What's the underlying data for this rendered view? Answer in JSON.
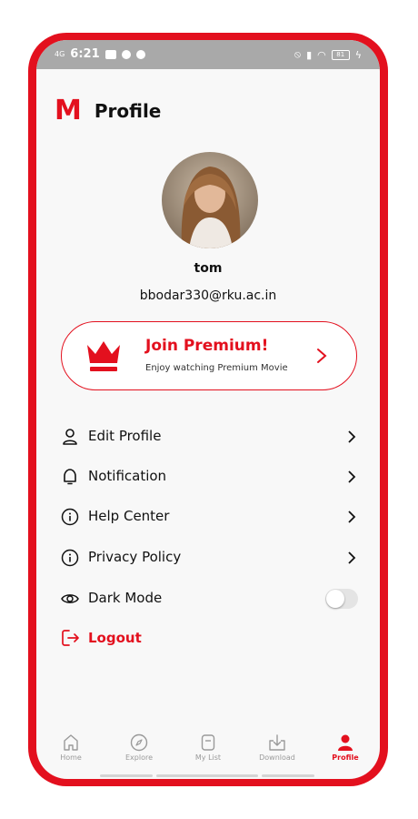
{
  "status_bar": {
    "time": "6:21",
    "network": "4G",
    "battery": "81"
  },
  "header": {
    "logo": "M",
    "title": "Profile"
  },
  "profile": {
    "name": "tom",
    "email": "bbodar330@rku.ac.in"
  },
  "premium": {
    "title": "Join Premium!",
    "subtitle": "Enjoy watching Premium Movie"
  },
  "menu": [
    {
      "label": "Edit Profile",
      "icon": "user-icon"
    },
    {
      "label": "Notification",
      "icon": "bell-icon"
    },
    {
      "label": "Help Center",
      "icon": "info-icon"
    },
    {
      "label": "Privacy Policy",
      "icon": "info-icon"
    },
    {
      "label": "Dark Mode",
      "icon": "eye-icon",
      "toggle": false
    }
  ],
  "logout": {
    "label": "Logout"
  },
  "nav": [
    {
      "label": "Home",
      "icon": "home-icon",
      "active": false
    },
    {
      "label": "Explore",
      "icon": "compass-icon",
      "active": false
    },
    {
      "label": "My List",
      "icon": "bookmark-icon",
      "active": false
    },
    {
      "label": "Download",
      "icon": "download-icon",
      "active": false
    },
    {
      "label": "Profile",
      "icon": "profile-icon",
      "active": true
    }
  ],
  "colors": {
    "brand": "#e3101e",
    "background": "#f8f8f8",
    "text": "#111111"
  }
}
